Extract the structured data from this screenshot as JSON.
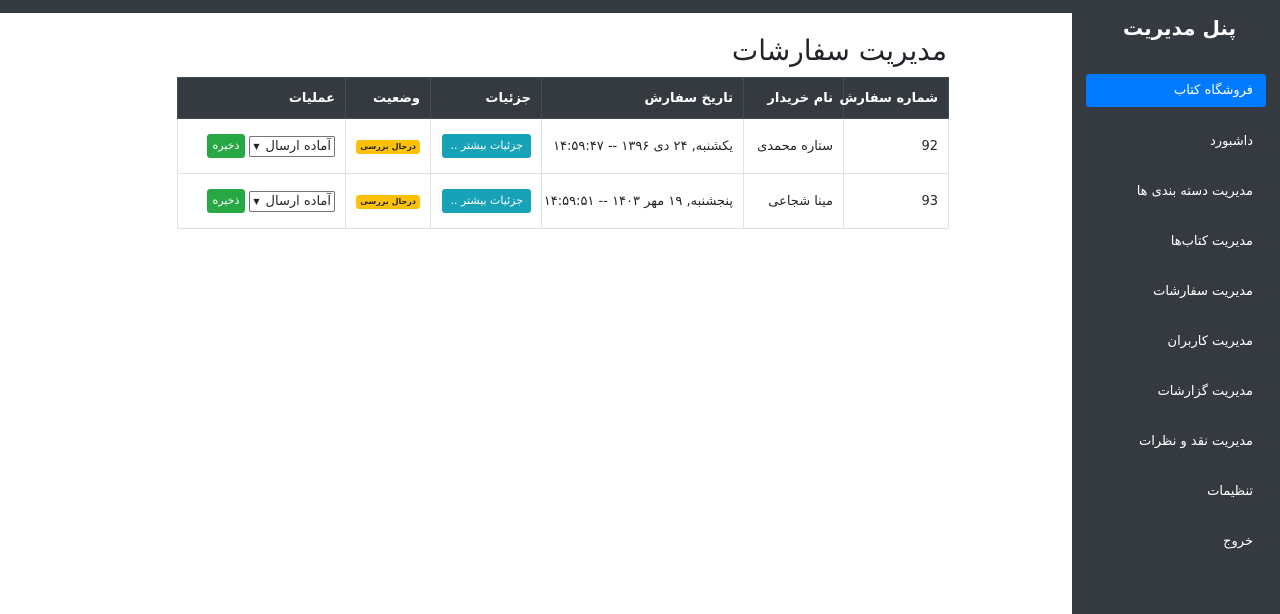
{
  "sidebar": {
    "title": "پنل مدیریت",
    "items": [
      {
        "label": "فروشگاه کتاب",
        "active": true
      },
      {
        "label": "داشبورد"
      },
      {
        "label": "مدیریت دسته بندی ها"
      },
      {
        "label": "مدیریت کتاب‌ها"
      },
      {
        "label": "مدیریت سفارشات"
      },
      {
        "label": "مدیریت کاربران"
      },
      {
        "label": "مدیریت گزارشات"
      },
      {
        "label": "مدیریت نقد و نظرات"
      },
      {
        "label": "تنظیمات"
      },
      {
        "label": "خروج"
      }
    ]
  },
  "main": {
    "title": "مدیریت سفارشات",
    "table": {
      "headers": [
        "شماره سفارش",
        "نام خریدار",
        "تاریخ سفارش",
        "جزئیات",
        "وضعیت",
        "عملیات"
      ],
      "rows": [
        {
          "order_number": "92",
          "buyer": "ستاره محمدی",
          "date": "یکشنبه, ۲۴ دی ۱۳۹۶ -- ۱۴:۵۹:۴۷",
          "details_label": "جزئیات بیشتر ..",
          "status": "درحال بررسی",
          "save_label": "ذخیره",
          "select_value": "آماده ارسال"
        },
        {
          "order_number": "93",
          "buyer": "مینا شجاعی",
          "date": "پنجشنبه, ۱۹ مهر ۱۴۰۳ -- ۱۴:۵۹:۵۱",
          "details_label": "جزئیات بیشتر ..",
          "status": "درحال بررسی",
          "save_label": "ذخیره",
          "select_value": "آماده ارسال"
        }
      ]
    }
  },
  "colors": {
    "sidebar_bg": "#343a40",
    "active_item": "#007bff",
    "details_button": "#17a2b8",
    "status_badge": "#ffc107",
    "save_button": "#28a745"
  }
}
